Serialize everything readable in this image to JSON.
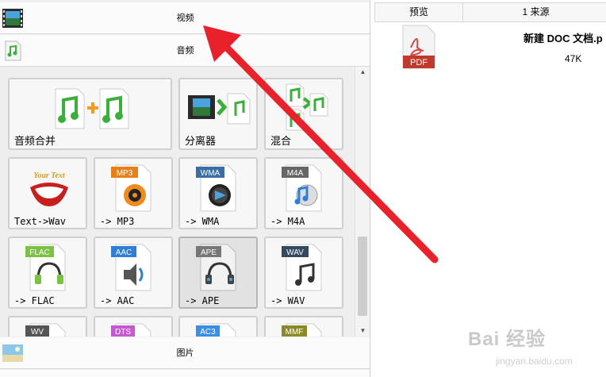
{
  "categories": {
    "video": "视频",
    "audio": "音频",
    "image": "图片"
  },
  "tiles": [
    {
      "label": "音频合并",
      "icon": "audio-merge-icon"
    },
    {
      "label": "分离器",
      "icon": "splitter-icon"
    },
    {
      "label": "混合",
      "icon": "mix-icon"
    },
    {
      "label": "Text->Wav",
      "icon": "text-to-wav-icon",
      "badge": "Your Text"
    },
    {
      "label": "-> MP3",
      "icon": "mp3-icon",
      "badge": "MP3"
    },
    {
      "label": "-> WMA",
      "icon": "wma-icon",
      "badge": "WMA"
    },
    {
      "label": "-> M4A",
      "icon": "m4a-icon",
      "badge": "M4A"
    },
    {
      "label": "-> FLAC",
      "icon": "flac-icon",
      "badge": "FLAC"
    },
    {
      "label": "-> AAC",
      "icon": "aac-icon",
      "badge": "AAC"
    },
    {
      "label": "-> APE",
      "icon": "ape-icon",
      "badge": "APE"
    },
    {
      "label": "-> WAV",
      "icon": "wav-icon",
      "badge": "WAV"
    },
    {
      "label": "",
      "icon": "wv-icon",
      "badge": "WV"
    },
    {
      "label": "",
      "icon": "dts-icon",
      "badge": "DTS"
    },
    {
      "label": "",
      "icon": "ac3-icon",
      "badge": "AC3"
    },
    {
      "label": "",
      "icon": "mmf-icon",
      "badge": "MMF"
    }
  ],
  "file_list": {
    "col_preview": "预览",
    "col_source": "1 来源",
    "file_name": "新建 DOC 文档.p",
    "file_size": "47K",
    "file_type": "PDF"
  },
  "watermark": {
    "brand": "Bai 经验",
    "url": "jingyan.baidu.com"
  },
  "colors": {
    "arrow": "#e8212a",
    "mp3": "#e8801a",
    "wma": "#3b6ea5",
    "m4a": "#666666",
    "flac": "#7cc242",
    "aac": "#2f7fd6",
    "ape": "#777777",
    "wav": "#34495e",
    "wv": "#555555",
    "dts": "#c45ad1",
    "ac3": "#3a8ee6",
    "mmf": "#8a8a2a"
  }
}
